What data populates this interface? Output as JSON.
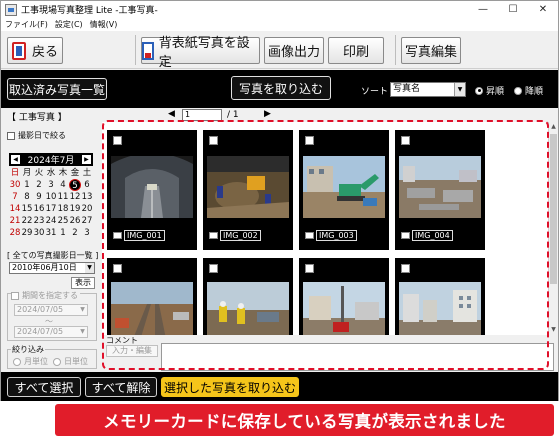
{
  "window": {
    "title": "工事現場写真整理 Lite -工事写真-",
    "minimize_glyph": "—",
    "maximize_glyph": "☐",
    "close_glyph": "✕"
  },
  "menu": [
    "ファイル(F)",
    "設定(C)",
    "情報(V)"
  ],
  "toolbar": {
    "back_label": "戻る",
    "set_wallpaper_label": "背表紙写真を設定",
    "image_output_label": "画像出力",
    "print_label": "印刷",
    "photo_edit_label": "写真編集"
  },
  "darkbar": {
    "imported_list_label": "取込済み写真一覧",
    "import_photos_label": "写真を取り込む",
    "sort_label": "ソート",
    "sort_value": "写真名",
    "asc_label": "昇順",
    "desc_label": "降順",
    "sort_order": "asc"
  },
  "nav": {
    "section_label": "【 工事写真 】",
    "prev_glyph": "◀",
    "next_glyph": "▶",
    "page_value": "1",
    "page_total": "/ 1"
  },
  "sidebar": {
    "filter_by_date_label": "撮影日で絞る",
    "calendar_title": "2024年7月",
    "weekdays": [
      "日",
      "月",
      "火",
      "水",
      "木",
      "金",
      "土"
    ],
    "days": [
      "30",
      "1",
      "2",
      "3",
      "4",
      "5",
      "6",
      "7",
      "8",
      "9",
      "10",
      "11",
      "12",
      "13",
      "14",
      "15",
      "16",
      "17",
      "18",
      "19",
      "20",
      "21",
      "22",
      "23",
      "24",
      "25",
      "26",
      "27",
      "28",
      "29",
      "30",
      "31",
      "1",
      "2",
      "3"
    ],
    "selected_day_index": 5,
    "all_dates_label": "[ 全ての写真撮影日一覧 ]",
    "all_dates_value": "2010年06月10日",
    "show_button_label": "表示",
    "period_label": "期間を指定する",
    "period_from": "2024/07/05",
    "period_sep": "〜",
    "period_to": "2024/07/05",
    "narrow_label": "絞り込み",
    "by_month_label": "月単位",
    "by_day_label": "日単位"
  },
  "photos": [
    {
      "name": "IMG_001",
      "scene": "tunnel"
    },
    {
      "name": "IMG_002",
      "scene": "excavation"
    },
    {
      "name": "IMG_003",
      "scene": "excavator"
    },
    {
      "name": "IMG_004",
      "scene": "foundation"
    },
    {
      "name": "",
      "scene": "rails"
    },
    {
      "name": "",
      "scene": "workers"
    },
    {
      "name": "",
      "scene": "pole"
    },
    {
      "name": "",
      "scene": "buildings"
    }
  ],
  "comment": {
    "label": "コメント",
    "input_edit_label": "入力・編集"
  },
  "bottom": {
    "select_all_label": "すべて選択",
    "deselect_all_label": "すべて解除",
    "import_selected_label": "選択した写真を取り込む"
  },
  "banner": {
    "text": "メモリーカードに保存している写真が表示されました"
  },
  "colors": {
    "highlight_red": "#e0102a",
    "banner_red": "#e11d2a",
    "accent_yellow": "#f5c51a"
  }
}
